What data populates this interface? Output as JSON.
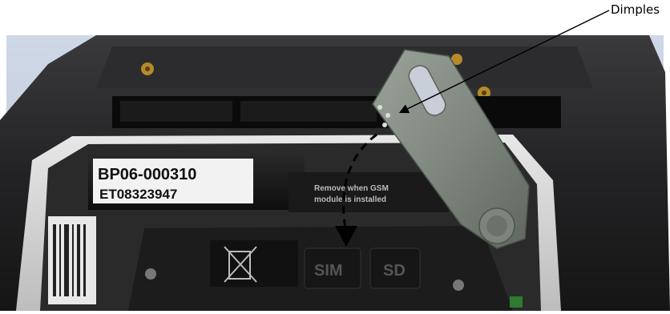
{
  "callout": {
    "label": "Dimples"
  },
  "battery_label": {
    "line1": "BP06-000310",
    "line2": "ET08323947"
  },
  "notice_sticker": {
    "line1": "Remove when GSM",
    "line2": "module is installed"
  },
  "slots": {
    "sim": "SIM",
    "sd": "SD"
  }
}
